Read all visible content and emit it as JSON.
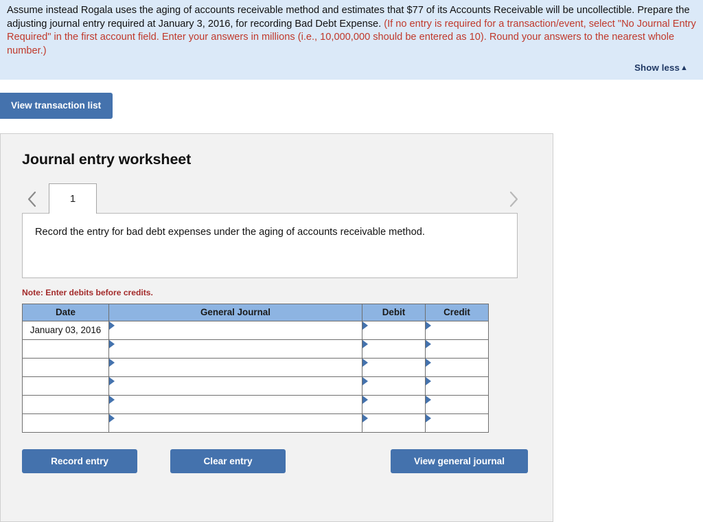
{
  "banner": {
    "text_black_1": "Assume instead Rogala uses the aging of accounts receivable method and estimates that $77 of its Accounts Receivable will be uncollectible. Prepare the adjusting journal entry required at January 3, 2016, for recording Bad Debt Expense. ",
    "text_red_1": "(If no entry is required for a transaction/event, select \"No Journal Entry Required\" in the first account field. Enter your answers in millions (i.e., 10,000,000 should be entered as 10). Round your answers to the nearest whole number.)",
    "show_less_label": "Show less",
    "show_less_caret": "▲",
    "background_color": "#dbe9f8",
    "red_color": "#c0392b",
    "link_color": "#1f3864"
  },
  "toolbar": {
    "view_transaction_list_label": "View transaction list"
  },
  "panel": {
    "title": "Journal entry worksheet",
    "prev_icon": "chevron-left-icon",
    "next_icon": "chevron-right-icon",
    "tabs": [
      {
        "label": "1",
        "active": true
      }
    ],
    "instruction": "Record the entry for bad debt expenses under the aging of accounts receivable method.",
    "note": "Note: Enter debits before credits.",
    "accent_color": "#4472ad",
    "header_color": "#8db4e2"
  },
  "table": {
    "columns": [
      "Date",
      "General Journal",
      "Debit",
      "Credit"
    ],
    "rows": [
      {
        "date": "January 03, 2016",
        "general_journal": "",
        "debit": "",
        "credit": ""
      },
      {
        "date": "",
        "general_journal": "",
        "debit": "",
        "credit": ""
      },
      {
        "date": "",
        "general_journal": "",
        "debit": "",
        "credit": ""
      },
      {
        "date": "",
        "general_journal": "",
        "debit": "",
        "credit": ""
      },
      {
        "date": "",
        "general_journal": "",
        "debit": "",
        "credit": ""
      },
      {
        "date": "",
        "general_journal": "",
        "debit": "",
        "credit": ""
      }
    ]
  },
  "footer": {
    "record_entry_label": "Record entry",
    "clear_entry_label": "Clear entry",
    "view_general_journal_label": "View general journal"
  }
}
